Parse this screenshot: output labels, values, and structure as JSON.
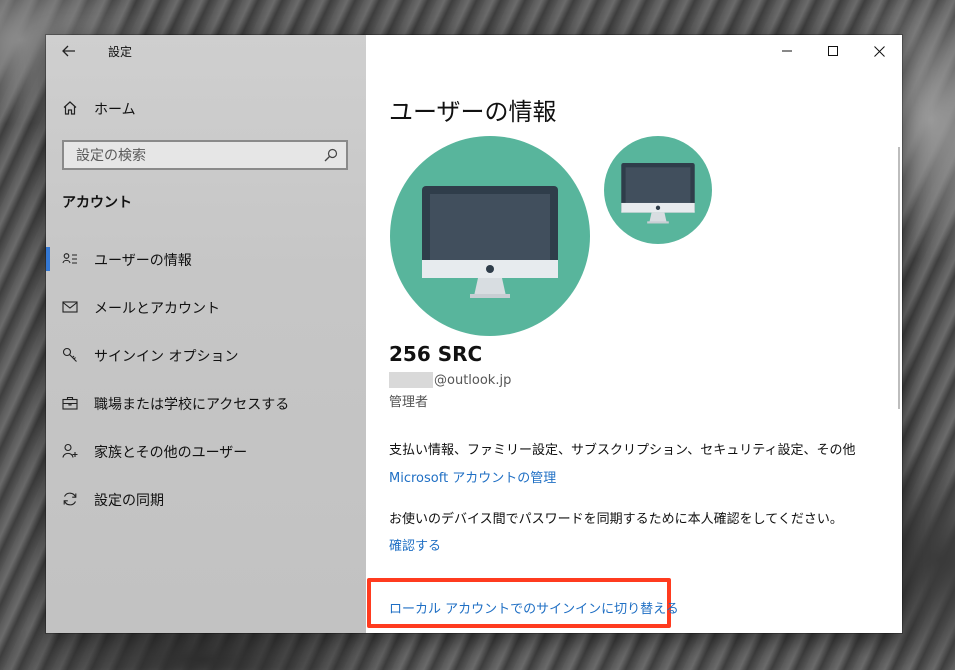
{
  "window": {
    "title": "設定"
  },
  "sidebar": {
    "home_label": "ホーム",
    "search_placeholder": "設定の検索",
    "section_heading": "アカウント",
    "items": [
      {
        "label": "ユーザーの情報",
        "icon": "user-info-icon",
        "active": true
      },
      {
        "label": "メールとアカウント",
        "icon": "mail-icon",
        "active": false
      },
      {
        "label": "サインイン オプション",
        "icon": "key-icon",
        "active": false
      },
      {
        "label": "職場または学校にアクセスする",
        "icon": "briefcase-icon",
        "active": false
      },
      {
        "label": "家族とその他のユーザー",
        "icon": "add-person-icon",
        "active": false
      },
      {
        "label": "設定の同期",
        "icon": "sync-icon",
        "active": false
      }
    ]
  },
  "main": {
    "page_title": "ユーザーの情報",
    "user_name": "256 SRC",
    "email_suffix": "@outlook.jp",
    "role": "管理者",
    "billing_text": "支払い情報、ファミリー設定、サブスクリプション、セキュリティ設定、その他",
    "manage_link": "Microsoft アカウントの管理",
    "verify_text": "お使いのデバイス間でパスワードを同期するために本人確認をしてください。",
    "verify_link": "確認する",
    "switch_link": "ローカル アカウントでのサインインに切り替える"
  },
  "colors": {
    "accent": "#3478d4",
    "link": "#1f6fc4",
    "avatar_bg": "#58b59c",
    "highlight": "#ff3b1f"
  }
}
